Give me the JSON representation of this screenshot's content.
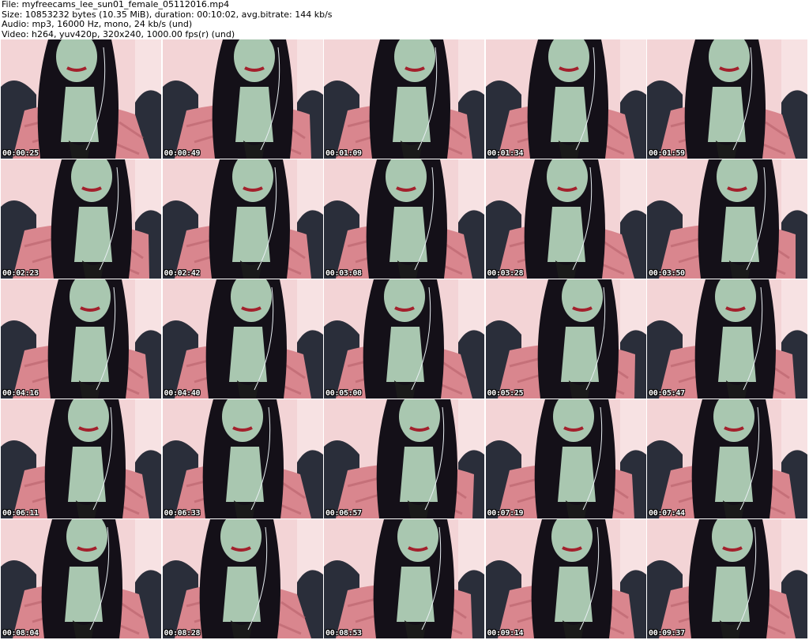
{
  "header": {
    "file_line": "File: myfreecams_lee_sun01_female_05112016.mp4",
    "size_line": "Size: 10853232 bytes (10.35 MiB), duration: 00:10:02, avg.bitrate: 144 kb/s",
    "audio_line": "Audio: mp3, 16000 Hz, mono, 24 kb/s (und)",
    "video_line": "Video: h264, yuv420p, 320x240, 1000.00 fps(r) (und)"
  },
  "thumbnails": [
    {
      "timestamp": "00:00:25"
    },
    {
      "timestamp": "00:00:49"
    },
    {
      "timestamp": "00:01:09"
    },
    {
      "timestamp": "00:01:34"
    },
    {
      "timestamp": "00:01:59"
    },
    {
      "timestamp": "00:02:23"
    },
    {
      "timestamp": "00:02:42"
    },
    {
      "timestamp": "00:03:08"
    },
    {
      "timestamp": "00:03:28"
    },
    {
      "timestamp": "00:03:50"
    },
    {
      "timestamp": "00:04:16"
    },
    {
      "timestamp": "00:04:40"
    },
    {
      "timestamp": "00:05:00"
    },
    {
      "timestamp": "00:05:25"
    },
    {
      "timestamp": "00:05:47"
    },
    {
      "timestamp": "00:06:11"
    },
    {
      "timestamp": "00:06:33"
    },
    {
      "timestamp": "00:06:57"
    },
    {
      "timestamp": "00:07:19"
    },
    {
      "timestamp": "00:07:44"
    },
    {
      "timestamp": "00:08:04"
    },
    {
      "timestamp": "00:08:28"
    },
    {
      "timestamp": "00:08:53"
    },
    {
      "timestamp": "00:09:14"
    },
    {
      "timestamp": "00:09:37"
    }
  ],
  "colors": {
    "background_wall": "#f3d4d6",
    "shirt": "#d9868e",
    "hair": "#141018",
    "skin": "#a9c7b0",
    "chair": "#2a2e3a"
  }
}
